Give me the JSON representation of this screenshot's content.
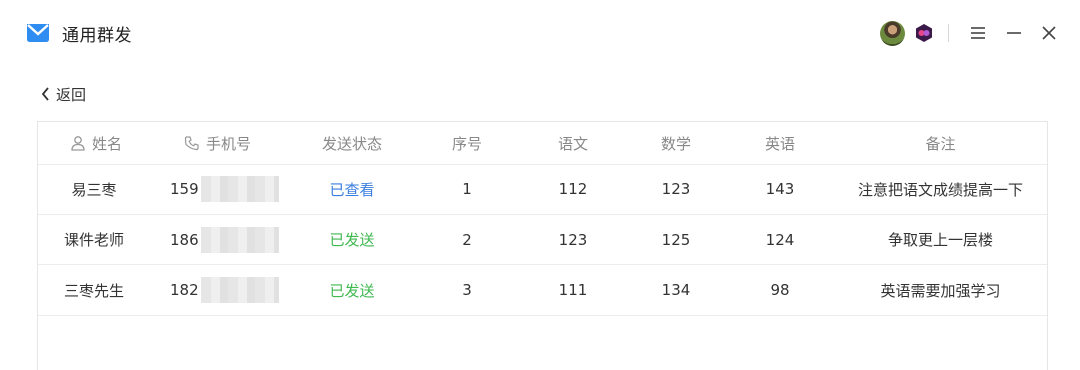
{
  "window": {
    "title": "通用群发",
    "accent": "#3a8ee6"
  },
  "nav": {
    "back_label": "返回"
  },
  "table": {
    "columns": [
      "姓名",
      "手机号",
      "发送状态",
      "序号",
      "语文",
      "数学",
      "英语",
      "备注"
    ],
    "rows": [
      {
        "name": "易三枣",
        "phone_prefix": "159",
        "status": "已查看",
        "status_color": "#3a7ee0",
        "seq": "1",
        "chinese": "112",
        "math": "123",
        "english": "143",
        "note": "注意把语文成绩提高一下"
      },
      {
        "name": "课件老师",
        "phone_prefix": "186",
        "status": "已发送",
        "status_color": "#3fb950",
        "seq": "2",
        "chinese": "123",
        "math": "125",
        "english": "124",
        "note": "争取更上一层楼"
      },
      {
        "name": "三枣先生",
        "phone_prefix": "182",
        "status": "已发送",
        "status_color": "#3fb950",
        "seq": "3",
        "chinese": "111",
        "math": "134",
        "english": "98",
        "note": "英语需要加强学习"
      }
    ]
  },
  "icons": {
    "app": "mail-icon",
    "user": "user-icon",
    "phone": "phone-icon",
    "menu": "hamburger-menu-icon",
    "minimize": "minimize-icon",
    "close": "close-icon",
    "back": "chevron-left-icon"
  }
}
